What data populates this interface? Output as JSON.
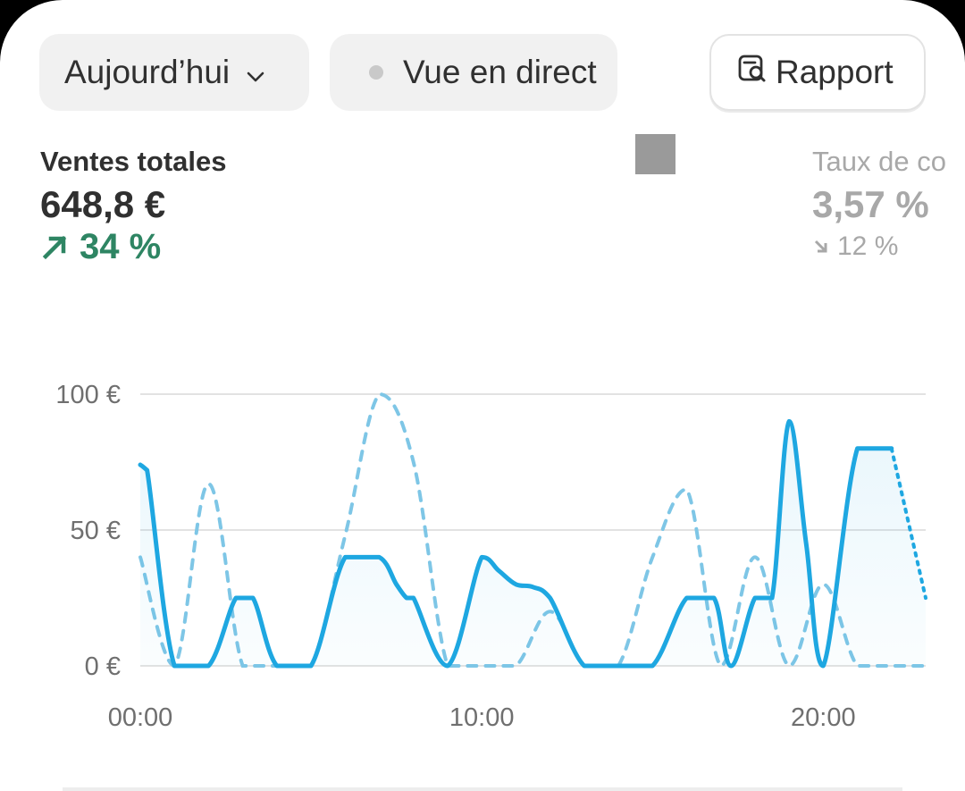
{
  "toolbar": {
    "date_label": "Aujourd’hui",
    "live_label": "Vue en direct",
    "report_label": "Rapport"
  },
  "metrics": [
    {
      "label": "Ventes totales",
      "value": "648,8 €",
      "change": "34 %",
      "direction": "up"
    },
    {
      "label": "Taux de co",
      "value": "3,57 %",
      "change": "12 %",
      "direction": "down"
    }
  ],
  "colors": {
    "primary_series": "#1ea7e1",
    "comparison_series": "#7ec6e6",
    "positive": "#2e8563",
    "muted": "#a8a8a8"
  },
  "chart_data": {
    "type": "line",
    "ylim": [
      0,
      100
    ],
    "y_ticks": [
      "0 €",
      "50 €",
      "100 €"
    ],
    "x_ticks": [
      "00:00",
      "10:00",
      "20:00"
    ],
    "x_range": [
      0,
      23
    ],
    "grid": true,
    "series": [
      {
        "style": "solid",
        "x": [
          0,
          0.2,
          1,
          2,
          2.8,
          3.3,
          4,
          5,
          6,
          7,
          7.5,
          7.8,
          8,
          9,
          10,
          10.5,
          11,
          11.5,
          12,
          13,
          14,
          15,
          16,
          16.8,
          17.3,
          18,
          18.5,
          19,
          19.5,
          20,
          21,
          22,
          23
        ],
        "y": [
          74,
          72,
          0,
          0,
          25,
          25,
          0,
          0,
          40,
          40,
          30,
          25,
          25,
          0,
          40,
          35,
          30,
          29,
          25,
          0,
          0,
          0,
          25,
          25,
          0,
          25,
          25,
          90,
          45,
          0,
          80,
          80,
          25
        ]
      },
      {
        "style": "dashed",
        "x": [
          0,
          1,
          2,
          3,
          4,
          5,
          6,
          7,
          8,
          9,
          10,
          11,
          12,
          13,
          14,
          15,
          16,
          17,
          18,
          19,
          20,
          21,
          22,
          23
        ],
        "y": [
          40,
          0,
          67,
          0,
          0,
          0,
          48,
          100,
          75,
          0,
          0,
          0,
          20,
          0,
          0,
          40,
          65,
          0,
          40,
          0,
          30,
          0,
          0,
          0
        ]
      }
    ]
  }
}
